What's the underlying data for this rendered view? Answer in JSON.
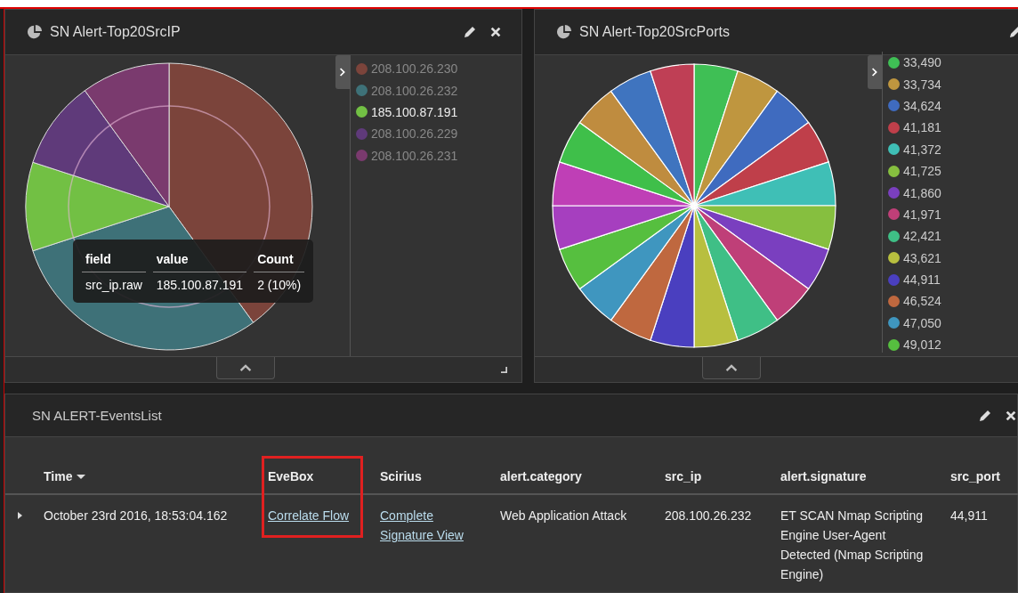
{
  "panels": [
    {
      "title": "SN Alert-Top20SrcIP",
      "legend": [
        {
          "label": "208.100.26.230",
          "color": "#7b443b",
          "highlighted": false
        },
        {
          "label": "208.100.26.232",
          "color": "#3e7178",
          "highlighted": false
        },
        {
          "label": "185.100.87.191",
          "color": "#72c044",
          "highlighted": true
        },
        {
          "label": "208.100.26.229",
          "color": "#5f3a7a",
          "highlighted": false
        },
        {
          "label": "208.100.26.231",
          "color": "#7a3a6e",
          "highlighted": false
        }
      ],
      "tooltip": {
        "columns": [
          "field",
          "value",
          "Count"
        ],
        "row": [
          "src_ip.raw",
          "185.100.87.191",
          "2 (10%)"
        ]
      }
    },
    {
      "title": "SN Alert-Top20SrcPorts",
      "legend": [
        {
          "label": "33,490",
          "color": "#3fbf55"
        },
        {
          "label": "33,734",
          "color": "#bf963f"
        },
        {
          "label": "34,624",
          "color": "#3f6bbf"
        },
        {
          "label": "41,181",
          "color": "#bf3f4a"
        },
        {
          "label": "41,372",
          "color": "#3fbfb6"
        },
        {
          "label": "41,725",
          "color": "#86bf3f"
        },
        {
          "label": "41,860",
          "color": "#7a3fbf"
        },
        {
          "label": "41,971",
          "color": "#bf3f78"
        },
        {
          "label": "42,421",
          "color": "#3fbf86"
        },
        {
          "label": "43,621",
          "color": "#b8bf3f"
        },
        {
          "label": "44,911",
          "color": "#4a3fbf"
        },
        {
          "label": "46,524",
          "color": "#bf683f"
        },
        {
          "label": "47,050",
          "color": "#3f96bf"
        },
        {
          "label": "49,012",
          "color": "#56bf3f"
        }
      ]
    }
  ],
  "events": {
    "title": "SN ALERT-EventsList",
    "columns": [
      {
        "label": "Time",
        "sorted": true,
        "highlighted": false
      },
      {
        "label": "EveBox",
        "sorted": false,
        "highlighted": true
      },
      {
        "label": "Scirius",
        "sorted": false,
        "highlighted": false
      },
      {
        "label": "alert.category",
        "sorted": false,
        "highlighted": false
      },
      {
        "label": "src_ip",
        "sorted": false,
        "highlighted": false
      },
      {
        "label": "alert.signature",
        "sorted": false,
        "highlighted": false
      },
      {
        "label": "src_port",
        "sorted": false,
        "highlighted": false
      }
    ],
    "rows": [
      {
        "expanded": false,
        "cells": [
          {
            "text": "October 23rd 2016, 18:53:04.162",
            "kind": "text"
          },
          {
            "text": "Correlate Flow",
            "kind": "link"
          },
          {
            "text": "Complete Signature View",
            "kind": "link"
          },
          {
            "text": "Web Application Attack",
            "kind": "text"
          },
          {
            "text": "208.100.26.232",
            "kind": "text"
          },
          {
            "text": "ET SCAN Nmap Scripting Engine User-Agent Detected (Nmap Scripting Engine)",
            "kind": "text"
          },
          {
            "text": "44,911",
            "kind": "text"
          }
        ]
      }
    ]
  }
}
